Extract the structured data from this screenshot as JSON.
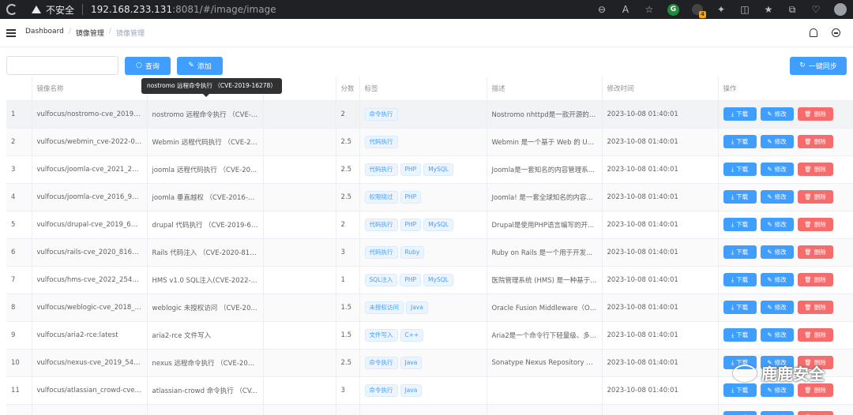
{
  "browser": {
    "insecure_label": "不安全",
    "url_host": "192.168.233.131",
    "url_rest": ":8081/#/image/image",
    "ext_badge": "4"
  },
  "header": {
    "breadcrumb": [
      "Dashboard",
      "镜像管理",
      "镜像管理"
    ]
  },
  "toolbar": {
    "search_value": "",
    "query_label": "查询",
    "add_label": "添加",
    "sync_label": "一键同步"
  },
  "table": {
    "columns": [
      "",
      "镜像名称",
      "",
      "端口",
      "分数",
      "标签",
      "描述",
      "修改时间",
      "操作"
    ],
    "action_labels": {
      "download": "下载",
      "edit": "修改",
      "delete": "删除"
    },
    "rows": [
      {
        "idx": "1",
        "name": "vulfocus/nostromo-cve_2019_16...",
        "vul": "nostromo 远程命令执行 （CVE-...",
        "port": "",
        "score": "2",
        "tags": [
          "命令执行"
        ],
        "desc": "Nostromo nhttpd是一款开源的W...",
        "time": "2023-10-08 01:40:01"
      },
      {
        "idx": "2",
        "name": "vulfocus/webmin_cve-2022-082...",
        "vul": "Webmin 远程代码执行 （CVE-2...",
        "port": "",
        "score": "2.5",
        "tags": [
          "代码执行"
        ],
        "desc": "Webmin 是一个基于 Web 的 Uni...",
        "time": "2023-10-08 01:40:01"
      },
      {
        "idx": "3",
        "name": "vulfocus/joomla-cve_2021_2313...",
        "vul": "joomla 远程代码执行 （CVE-20...",
        "port": "",
        "score": "2.5",
        "tags": [
          "代码执行",
          "PHP",
          "MySQL"
        ],
        "desc": "Joomla是一套知名的内容管理系...",
        "time": "2023-10-08 01:40:01"
      },
      {
        "idx": "4",
        "name": "vulfocus/joomla-cve_2016_9838...",
        "vul": "joomla 垂直越权 （CVE-2016-98...",
        "port": "",
        "score": "2.5",
        "tags": [
          "权限绕过",
          "PHP"
        ],
        "desc": "Joomla! 是一套全球知名的内容...",
        "time": "2023-10-08 01:40:01"
      },
      {
        "idx": "5",
        "name": "vulfocus/drupal-cve_2019_6340:...",
        "vul": "drupal 代码执行 （CVE-2019-63...",
        "port": "",
        "score": "2",
        "tags": [
          "代码执行",
          "PHP",
          "MySQL"
        ],
        "desc": "Drupal是使用PHP语言编写的开...",
        "time": "2023-10-08 01:40:01"
      },
      {
        "idx": "6",
        "name": "vulfocus/rails-cve_2020_8163:la...",
        "vul": "Rails 代码注入 （CVE-2020-816...",
        "port": "",
        "score": "3",
        "tags": [
          "代码执行",
          "Ruby"
        ],
        "desc": "Ruby on Rails 是一个用于开发...",
        "time": "2023-10-08 01:40:01"
      },
      {
        "idx": "7",
        "name": "vulfocus/hms-cve_2022_25491:l...",
        "vul": "HMS v1.0 SQL注入(CVE-2022-...",
        "port": "",
        "score": "1",
        "tags": [
          "SQL注入",
          "PHP",
          "MySQL"
        ],
        "desc": "医院管理系统 (HMS) 是一种基于...",
        "time": "2023-10-08 01:40:01"
      },
      {
        "idx": "8",
        "name": "vulfocus/weblogic-cve_2018_32...",
        "vul": "weblogic 未授权访问 （CVE-20...",
        "port": "",
        "score": "1.5",
        "tags": [
          "未授权访问",
          "Java"
        ],
        "desc": "Oracle Fusion Middleware（Ora...",
        "time": "2023-10-08 01:40:01"
      },
      {
        "idx": "9",
        "name": "vulfocus/aria2-rce:latest",
        "vul": "aria2-rce 文件写入",
        "port": "",
        "score": "1.5",
        "tags": [
          "文件写入",
          "C++"
        ],
        "desc": "Aria2是一个命令行下轻量级、多...",
        "time": "2023-10-08 01:40:01"
      },
      {
        "idx": "10",
        "name": "vulfocus/nexus-cve_2019_5475:...",
        "vul": "nexus 远程命令执行 （CVE-201...",
        "port": "",
        "score": "2.5",
        "tags": [
          "命令执行",
          "Java"
        ],
        "desc": "Sonatype Nexus Repository Ma...",
        "time": "2023-10-08 01:40:01"
      },
      {
        "idx": "11",
        "name": "vulfocus/atlassian_crowd-cve_2...",
        "vul": "atlassian-crowd 命令执行 （CV...",
        "port": "",
        "score": "3",
        "tags": [
          "命令执行",
          "Java"
        ],
        "desc": "",
        "time": "2023-10-08 01:40:01"
      },
      {
        "idx": "",
        "name": "",
        "vul": "",
        "port": "",
        "score": "",
        "tags": [
          "",
          ""
        ],
        "desc": "",
        "time": ""
      }
    ]
  },
  "tooltip": {
    "text": "nostromo 远程命令执行 （CVE-2019-16278）"
  },
  "watermark": {
    "text": "鹿鹿安全"
  }
}
